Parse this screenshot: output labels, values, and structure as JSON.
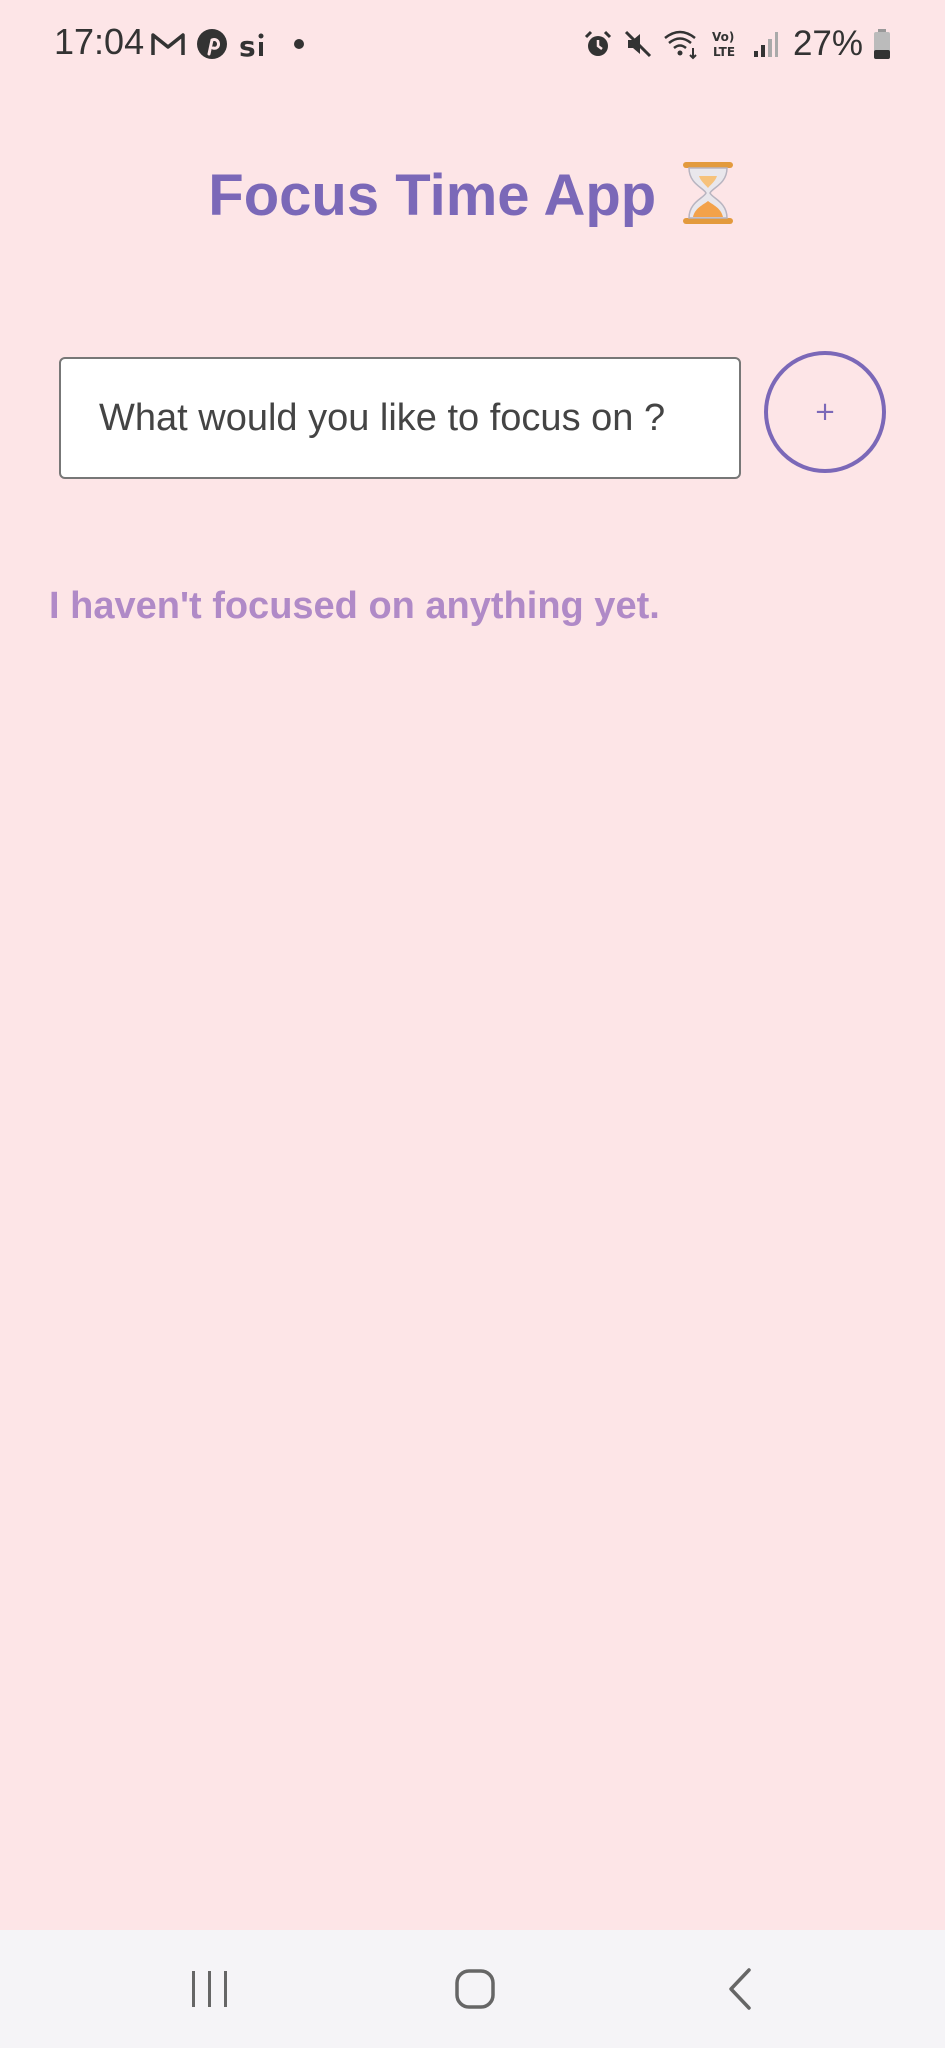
{
  "status_bar": {
    "time": "17:04",
    "battery": "27%",
    "left_icons": [
      "gmail-icon",
      "pinterest-icon",
      "si-app-icon",
      "notification-dot"
    ],
    "right_icons": [
      "alarm-icon",
      "mute-icon",
      "wifi-icon",
      "volte-icon",
      "signal-icon",
      "battery-icon"
    ]
  },
  "app": {
    "title": "Focus Time App",
    "title_icon": "hourglass-icon",
    "accent_color": "#7b68b8",
    "background_color": "#fde5e7"
  },
  "focus_input": {
    "value": "",
    "placeholder": "What would you like to focus on ?"
  },
  "add_button": {
    "label": "+"
  },
  "empty_state": {
    "message": "I haven't focused on anything yet."
  },
  "nav_bar": {
    "buttons": [
      "recent-apps",
      "home",
      "back"
    ]
  }
}
